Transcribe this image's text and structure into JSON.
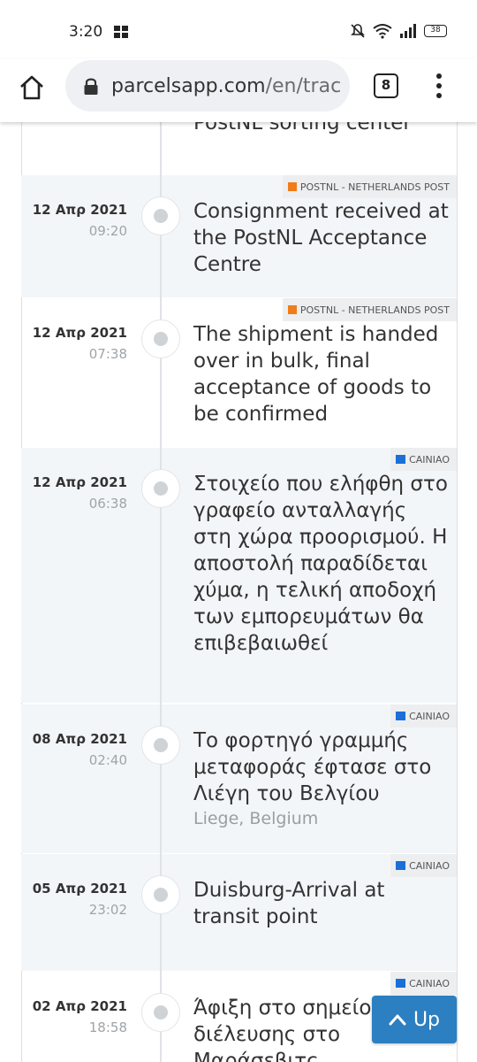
{
  "status_bar": {
    "time": "3:20",
    "battery": "38"
  },
  "browser": {
    "url_domain": "parcelsapp.com",
    "url_path": "/en/trac",
    "tab_count": "8"
  },
  "partial_event_text": "PostNL sorting center",
  "events": [
    {
      "date": "12 Απρ 2021",
      "time": "09:20",
      "description": "Consignment received at the PostNL Acceptance Centre",
      "location": "",
      "carrier": "POSTNL - NETHERLANDS POST",
      "carrier_icon": "postnl-logo-icon"
    },
    {
      "date": "12 Απρ 2021",
      "time": "07:38",
      "description": "The shipment is handed over in bulk, final acceptance of goods to be confirmed",
      "location": "",
      "carrier": "POSTNL - NETHERLANDS POST",
      "carrier_icon": "postnl-logo-icon"
    },
    {
      "date": "12 Απρ 2021",
      "time": "06:38",
      "description": "Στοιχείο που ελήφθη στο γραφείο ανταλλαγής στη χώρα προορισμού. Η αποστολή παραδίδεται χύμα, η τελική αποδοχή των εμπορευμάτων θα επιβεβαιωθεί",
      "location": "",
      "carrier": "CAINIAO",
      "carrier_icon": "cainiao-logo-icon"
    },
    {
      "date": "08 Απρ 2021",
      "time": "02:40",
      "description": "Το φορτηγό γραμμής μεταφοράς έφτασε στο Λιέγη του Βελγίου",
      "location": "Liege, Belgium",
      "carrier": "CAINIAO",
      "carrier_icon": "cainiao-logo-icon"
    },
    {
      "date": "05 Απρ 2021",
      "time": "23:02",
      "description": "Duisburg-Arrival at transit point",
      "location": "",
      "carrier": "CAINIAO",
      "carrier_icon": "cainiao-logo-icon"
    },
    {
      "date": "02 Απρ 2021",
      "time": "18:58",
      "description": "Άφιξη στο σημείο διέλευσης στο Μαράσεβιτς",
      "location": "",
      "carrier": "CAINIAO",
      "carrier_icon": "cainiao-logo-icon"
    }
  ],
  "up_button": {
    "label": "Up",
    "color": "#2c7fc0"
  }
}
